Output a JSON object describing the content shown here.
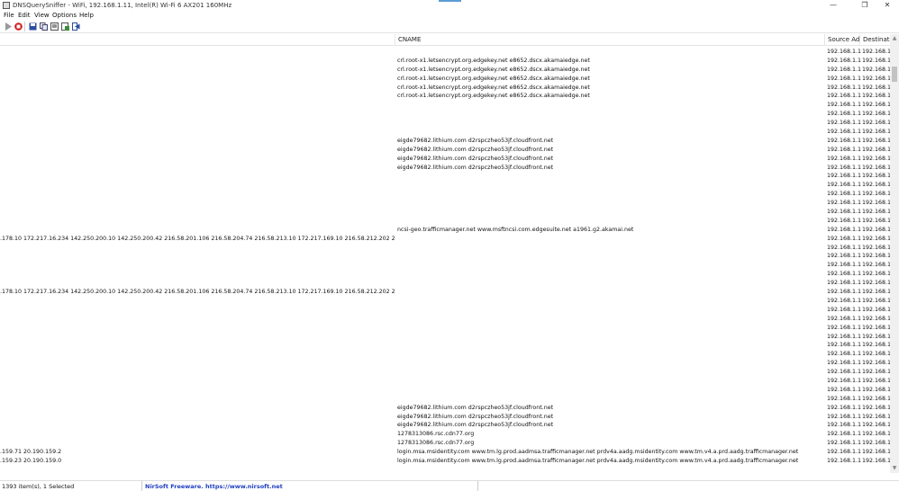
{
  "window": {
    "title": "DNSQuerySniffer  -  WiFi, 192.168.1.11, Intel(R) Wi-Fi 6 AX201 160MHz"
  },
  "menu": {
    "items": [
      "File",
      "Edit",
      "View",
      "Options",
      "Help"
    ]
  },
  "toolbar": {
    "icons": [
      "play-icon",
      "stop-icon",
      "save-icon",
      "copy-icon",
      "properties-icon",
      "html-report-icon",
      "exit-icon"
    ]
  },
  "columns": {
    "cname": "CNAME",
    "source": "Source Ad...",
    "destination": "Destinati..."
  },
  "rows": [
    {
      "ip": "",
      "cname": "",
      "src": "192.168.1.11",
      "dst": "192.168.1.1"
    },
    {
      "ip": "",
      "cname": "crl.root-x1.letsencrypt.org.edgekey.net  e8652.dscx.akamaiedge.net",
      "src": "192.168.1.11",
      "dst": "192.168.1.1"
    },
    {
      "ip": "",
      "cname": "crl.root-x1.letsencrypt.org.edgekey.net  e8652.dscx.akamaiedge.net",
      "src": "192.168.1.11",
      "dst": "192.168.1.1"
    },
    {
      "ip": "",
      "cname": "crl.root-x1.letsencrypt.org.edgekey.net  e8652.dscx.akamaiedge.net",
      "src": "192.168.1.11",
      "dst": "192.168.1.1"
    },
    {
      "ip": "",
      "cname": "crl.root-x1.letsencrypt.org.edgekey.net  e8652.dscx.akamaiedge.net",
      "src": "192.168.1.11",
      "dst": "192.168.1.1"
    },
    {
      "ip": "",
      "cname": "crl.root-x1.letsencrypt.org.edgekey.net  e8652.dscx.akamaiedge.net",
      "src": "192.168.1.11",
      "dst": "192.168.1.1"
    },
    {
      "ip": "",
      "cname": "",
      "src": "192.168.1.11",
      "dst": "192.168.1.1"
    },
    {
      "ip": "",
      "cname": "",
      "src": "192.168.1.11",
      "dst": "192.168.1.1"
    },
    {
      "ip": "",
      "cname": "",
      "src": "192.168.1.11",
      "dst": "192.168.1.1"
    },
    {
      "ip": "",
      "cname": "",
      "src": "192.168.1.11",
      "dst": "192.168.1.1"
    },
    {
      "ip": "",
      "cname": "eigde79682.lithium.com  d2rspczheo53jf.cloudfront.net",
      "src": "192.168.1.11",
      "dst": "192.168.1.1"
    },
    {
      "ip": "",
      "cname": "eigde79682.lithium.com  d2rspczheo53jf.cloudfront.net",
      "src": "192.168.1.11",
      "dst": "192.168.1.1"
    },
    {
      "ip": "",
      "cname": "eigde79682.lithium.com  d2rspczheo53jf.cloudfront.net",
      "src": "192.168.1.11",
      "dst": "192.168.1.1"
    },
    {
      "ip": "",
      "cname": "eigde79682.lithium.com  d2rspczheo53jf.cloudfront.net",
      "src": "192.168.1.11",
      "dst": "192.168.1.1"
    },
    {
      "ip": "",
      "cname": "",
      "src": "192.168.1.11",
      "dst": "192.168.1.1"
    },
    {
      "ip": "",
      "cname": "",
      "src": "192.168.1.11",
      "dst": "192.168.1.1"
    },
    {
      "ip": "",
      "cname": "",
      "src": "192.168.1.11",
      "dst": "192.168.1.1"
    },
    {
      "ip": "",
      "cname": "",
      "src": "192.168.1.11",
      "dst": "192.168.1.1"
    },
    {
      "ip": "",
      "cname": "",
      "src": "192.168.1.11",
      "dst": "192.168.1.1"
    },
    {
      "ip": "",
      "cname": "",
      "src": "192.168.1.11",
      "dst": "192.168.1.1"
    },
    {
      "ip": "",
      "cname": "ncsi-geo.trafficmanager.net  www.msftncsi.com.edgesuite.net  a1961.g2.akamai.net",
      "src": "192.168.1.11",
      "dst": "192.168.1.1"
    },
    {
      "ip": ".178.10  172.217.16.234  142.250.200.10  142.250.200.42  216.58.201.106  216.58.204.74  216.58.213.10  172.217.169.10  216.58.212.202  216.58.212.234",
      "cname": "",
      "src": "192.168.1.11",
      "dst": "192.168.1.1"
    },
    {
      "ip": "",
      "cname": "",
      "src": "192.168.1.11",
      "dst": "192.168.1.1"
    },
    {
      "ip": "",
      "cname": "",
      "src": "192.168.1.11",
      "dst": "192.168.1.1"
    },
    {
      "ip": "",
      "cname": "",
      "src": "192.168.1.11",
      "dst": "192.168.1.1"
    },
    {
      "ip": "",
      "cname": "",
      "src": "192.168.1.11",
      "dst": "192.168.1.1"
    },
    {
      "ip": "",
      "cname": "",
      "src": "192.168.1.11",
      "dst": "192.168.1.1"
    },
    {
      "ip": ".178.10  172.217.16.234  142.250.200.10  142.250.200.42  216.58.201.106  216.58.204.74  216.58.213.10  172.217.169.10  216.58.212.202  216.58.212.234",
      "cname": "",
      "src": "192.168.1.11",
      "dst": "192.168.1.1"
    },
    {
      "ip": "",
      "cname": "",
      "src": "192.168.1.11",
      "dst": "192.168.1.1"
    },
    {
      "ip": "",
      "cname": "",
      "src": "192.168.1.11",
      "dst": "192.168.1.1"
    },
    {
      "ip": "",
      "cname": "",
      "src": "192.168.1.11",
      "dst": "192.168.1.1"
    },
    {
      "ip": "",
      "cname": "",
      "src": "192.168.1.11",
      "dst": "192.168.1.1"
    },
    {
      "ip": "",
      "cname": "",
      "src": "192.168.1.11",
      "dst": "192.168.1.1"
    },
    {
      "ip": "",
      "cname": "",
      "src": "192.168.1.11",
      "dst": "192.168.1.1"
    },
    {
      "ip": "",
      "cname": "",
      "src": "192.168.1.11",
      "dst": "192.168.1.1"
    },
    {
      "ip": "",
      "cname": "",
      "src": "192.168.1.11",
      "dst": "192.168.1.1"
    },
    {
      "ip": "",
      "cname": "",
      "src": "192.168.1.11",
      "dst": "192.168.1.1"
    },
    {
      "ip": "",
      "cname": "",
      "src": "192.168.1.11",
      "dst": "192.168.1.1"
    },
    {
      "ip": "",
      "cname": "",
      "src": "192.168.1.11",
      "dst": "192.168.1.1"
    },
    {
      "ip": "",
      "cname": "",
      "src": "192.168.1.11",
      "dst": "192.168.1.1"
    },
    {
      "ip": "",
      "cname": "eigde79682.lithium.com  d2rspczheo53jf.cloudfront.net",
      "src": "192.168.1.11",
      "dst": "192.168.1.1"
    },
    {
      "ip": "",
      "cname": "eigde79682.lithium.com  d2rspczheo53jf.cloudfront.net",
      "src": "192.168.1.11",
      "dst": "192.168.1.1"
    },
    {
      "ip": "",
      "cname": "eigde79682.lithium.com  d2rspczheo53jf.cloudfront.net",
      "src": "192.168.1.11",
      "dst": "192.168.1.1"
    },
    {
      "ip": "",
      "cname": "1278313086.rsc.cdn77.org",
      "src": "192.168.1.11",
      "dst": "192.168.1.1"
    },
    {
      "ip": "",
      "cname": "1278313086.rsc.cdn77.org",
      "src": "192.168.1.11",
      "dst": "192.168.1.1"
    },
    {
      "ip": ".159.71  20.190.159.2",
      "cname": "login.msa.msidentity.com  www.tm.lg.prod.aadmsa.trafficmanager.net  prdv4a.aadg.msidentity.com  www.tm.v4.a.prd.aadg.trafficmanager.net",
      "src": "192.168.1.11",
      "dst": "192.168.1.1"
    },
    {
      "ip": ".159.23  20.190.159.0",
      "cname": "login.msa.msidentity.com  www.tm.lg.prod.aadmsa.trafficmanager.net  prdv4a.aadg.msidentity.com  www.tm.v4.a.prd.aadg.trafficmanager.net",
      "src": "192.168.1.11",
      "dst": "192.168.1.1"
    }
  ],
  "status": {
    "items_text": "1393 item(s), 1 Selected",
    "freeware_text": "NirSoft Freeware. https://www.nirsoft.net"
  }
}
